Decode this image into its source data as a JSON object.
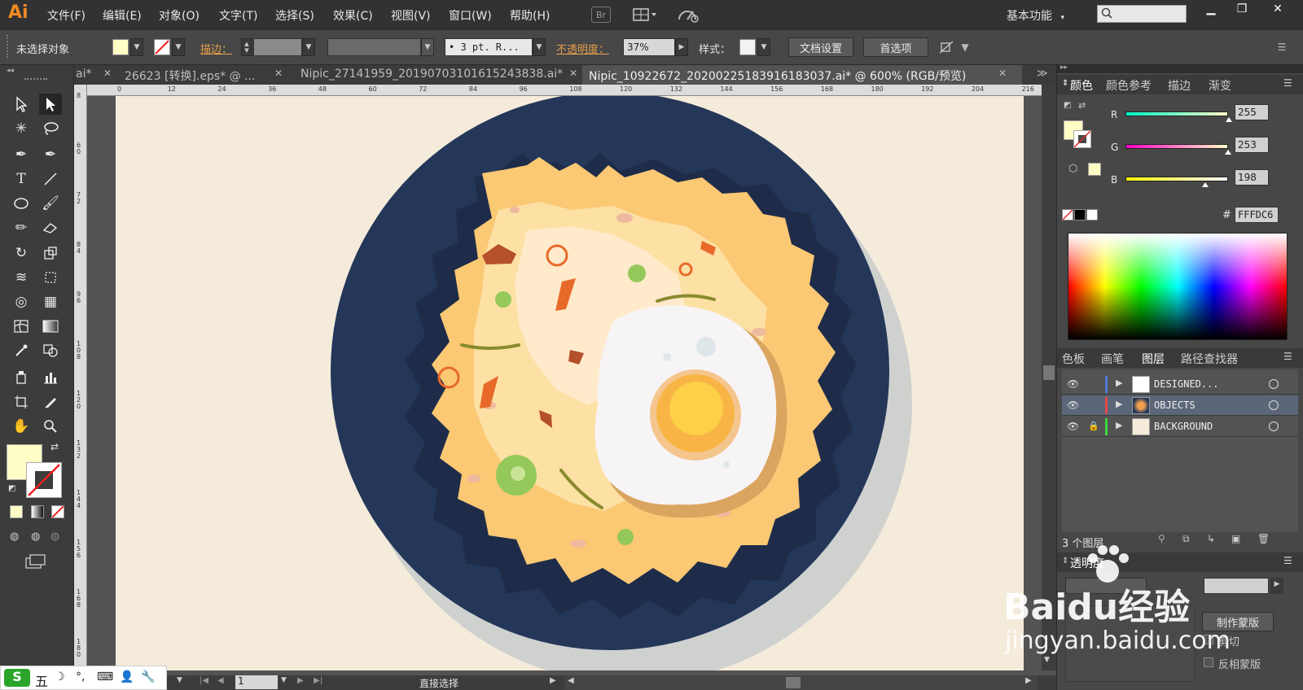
{
  "app": {
    "logo": "Ai"
  },
  "menu": [
    "文件(F)",
    "编辑(E)",
    "对象(O)",
    "文字(T)",
    "选择(S)",
    "效果(C)",
    "视图(V)",
    "窗口(W)",
    "帮助(H)"
  ],
  "menubar": {
    "br_badge": "Br",
    "workspace": "基本功能"
  },
  "control": {
    "selection_status": "未选择对象",
    "stroke_label": "描边：",
    "stroke_profile": "• 3 pt. R...",
    "opacity_label": "不透明度：",
    "opacity_value": "37%",
    "style_label": "样式：",
    "doc_setup": "文档设置",
    "preferences": "首选项"
  },
  "tabs": [
    {
      "label": "ai*",
      "active": false
    },
    {
      "label": "26623 [转换].eps* @ ...",
      "active": false
    },
    {
      "label": "Nipic_27141959_20190703101615243838.ai*",
      "active": false
    },
    {
      "label": "Nipic_10922672_20200225183916183037.ai* @ 600% (RGB/预览)",
      "active": true
    }
  ],
  "ruler_top": [
    "0",
    "12",
    "24",
    "36",
    "48",
    "60",
    "72",
    "84",
    "96",
    "108",
    "120",
    "132",
    "144",
    "156",
    "168",
    "180",
    "192",
    "204",
    "216"
  ],
  "ruler_left": [
    "8",
    "6 0",
    "7 2",
    "8 4",
    "9 6",
    "1 0 8",
    "1 2 0",
    "1 3 2",
    "1 4 4",
    "1 5 6",
    "1 6 8",
    "1 8 0"
  ],
  "color_panel": {
    "tabs": [
      "颜色",
      "颜色参考",
      "描边",
      "渐变"
    ],
    "r_label": "R",
    "g_label": "G",
    "b_label": "B",
    "r": "255",
    "g": "253",
    "b": "198",
    "r_frac": 1.0,
    "g_frac": 0.992,
    "b_frac": 0.776,
    "hash": "#",
    "hex": "FFFDC6",
    "fill_color": "#FFFDC6"
  },
  "layers_panel": {
    "tabs": [
      "色板",
      "画笔",
      "图层",
      "路径查找器"
    ],
    "layers": [
      {
        "name": "DESIGNED...",
        "color": "#4f7bd8",
        "locked": false,
        "selected": false
      },
      {
        "name": "OBJECTS",
        "color": "#e24a4a",
        "locked": false,
        "selected": true
      },
      {
        "name": "BACKGROUND",
        "color": "#3fd43f",
        "locked": true,
        "selected": false
      }
    ],
    "count": "3 个图层"
  },
  "transparency_panel": {
    "title": "透明度",
    "make_mask": "制作蒙版",
    "clip": "剪切",
    "invert_mask": "反相蒙版"
  },
  "status": {
    "page": "1",
    "tool": "直接选择"
  },
  "watermark": {
    "brand": "Baidu经验",
    "url": "jingyan.baidu.com"
  },
  "ime": {
    "mode": "五"
  },
  "colors": {
    "plate": "#243759",
    "plate_shadow": "#cfd1cf",
    "artboard": "#f4ebdb",
    "rice": "#f9c874",
    "egg_white": "#f7f4f6",
    "yolk": "#fdd048"
  }
}
